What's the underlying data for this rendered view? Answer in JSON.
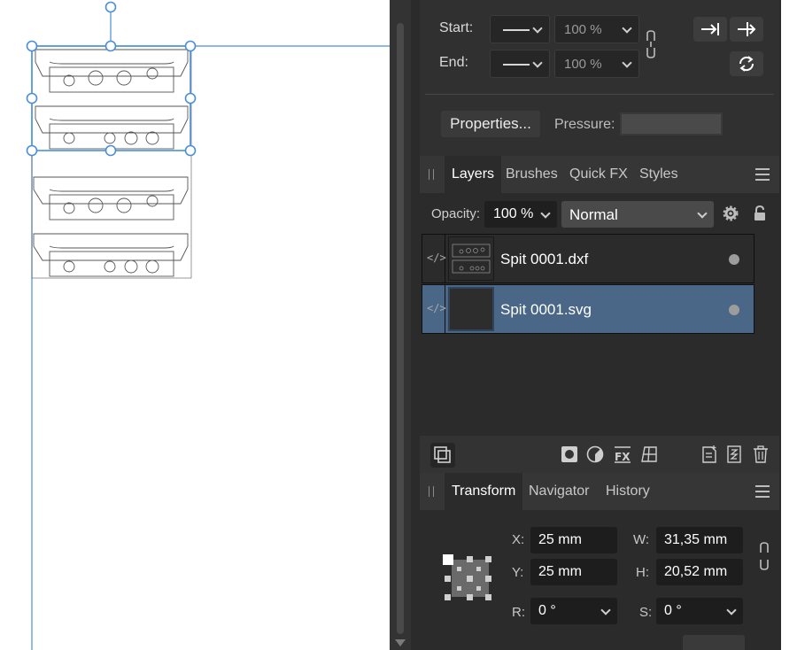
{
  "stroke": {
    "start_label": "Start:",
    "end_label": "End:",
    "start_percent": "100 %",
    "end_percent": "100 %",
    "properties_label": "Properties...",
    "pressure_label": "Pressure:"
  },
  "layers_panel": {
    "tabs": [
      "Layers",
      "Brushes",
      "Quick FX",
      "Styles"
    ],
    "opacity_label": "Opacity:",
    "opacity_value": "100 %",
    "blend_mode": "Normal",
    "layers": [
      {
        "name": "Spit 0001.dxf",
        "selected": false
      },
      {
        "name": "Spit 0001.svg",
        "selected": true
      }
    ]
  },
  "transform_panel": {
    "tabs": [
      "Transform",
      "Navigator",
      "History"
    ],
    "x_label": "X:",
    "x_value": "25 mm",
    "y_label": "Y:",
    "y_value": "25 mm",
    "w_label": "W:",
    "w_value": "31,35 mm",
    "h_label": "H:",
    "h_value": "20,52 mm",
    "r_label": "R:",
    "r_value": "0 °",
    "s_label": "S:",
    "s_value": "0 °"
  },
  "colors": {
    "selection_blue": "#4a8fd6",
    "selected_layer": "#4a6788",
    "panel_bg": "#2b2b2b"
  },
  "icons": [
    "arrow-to-line-icon",
    "arrow-right-icon",
    "rotate-icon",
    "link-icon",
    "gear-icon",
    "lock-icon",
    "code-icon",
    "mask-icon",
    "adjustment-icon",
    "fx-icon",
    "grid-icon",
    "add-layer-icon",
    "group-icon",
    "trash-icon",
    "hamburger-icon"
  ]
}
